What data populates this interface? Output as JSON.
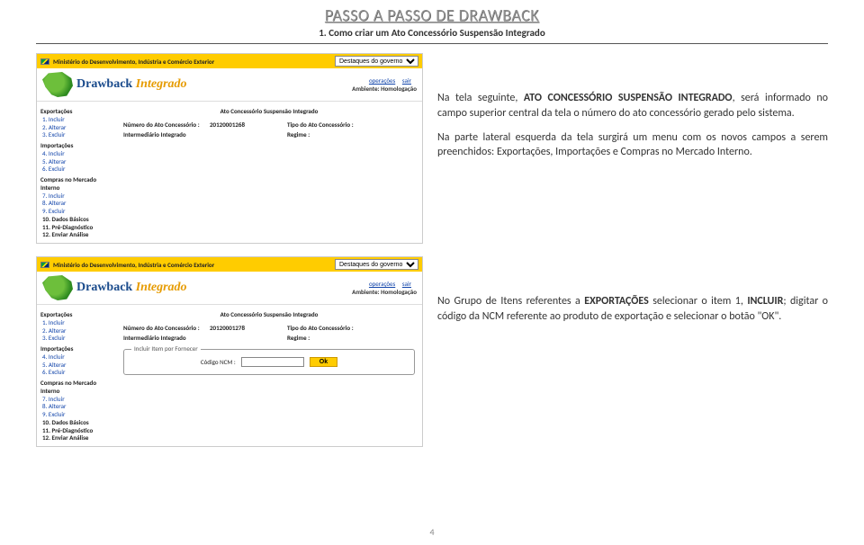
{
  "header": {
    "title": "PASSO A PASSO DE DRAWBACK",
    "subtitle": "1. Como criar um Ato Concessório Suspensão Integrado"
  },
  "gov": {
    "ministry": "Ministério do Desenvolvimento, Indústria e Comércio Exterior",
    "dropdown": "Destaques do governo"
  },
  "app": {
    "name_a": "Drawback",
    "name_b": "Integrado",
    "ops": "operações",
    "exit": "sair",
    "env": "Ambiente: Homologação"
  },
  "panel": {
    "title": "Ato Concessório Suspensão Integrado",
    "num_label": "Número do Ato Concessório :",
    "num_val1": "20120001268",
    "num_val2": "20120001278",
    "interm_label": "Intermediário Integrado",
    "tipo_label": "Tipo do Ato Concessório :",
    "regime_label": "Regime :",
    "fieldset_legend": "Incluir Item por Fornecer",
    "ncm_label": "Código NCM :",
    "ok": "Ok"
  },
  "sidebar": {
    "g1": "Exportações",
    "i1": "1. Incluir",
    "i2": "2. Alterar",
    "i3": "3. Excluir",
    "g2": "Importações",
    "i4": "4. Incluir",
    "i5": "5. Alterar",
    "i6": "6. Excluir",
    "g3": "Compras no Mercado Interno",
    "i7": "7. Incluir",
    "i8": "8. Alterar",
    "i9": "9. Excluir",
    "i10": "10. Dados Básicos",
    "i11": "11. Pré-Diagnóstico",
    "i12": "12. Enviar Análise"
  },
  "desc": {
    "p1a": "Na tela seguinte, ",
    "p1b": "ATO CONCESSÓRIO SUSPENSÃO INTEGRADO",
    "p1c": ", será informado no campo superior central da tela o número do ato concessório gerado pelo sistema.",
    "p2": "Na parte lateral esquerda da tela surgirá um menu com os novos campos a serem preenchidos: Exportações, Importações e Compras no Mercado Interno.",
    "p3a": "No Grupo de Itens referentes a ",
    "p3b": "EXPORTAÇÕES",
    "p3c": " selecionar o item 1, ",
    "p3d": "INCLUIR",
    "p3e": "; digitar o código da NCM referente ao produto de exportação e selecionar o botão \"OK\"."
  },
  "page_num": "4"
}
